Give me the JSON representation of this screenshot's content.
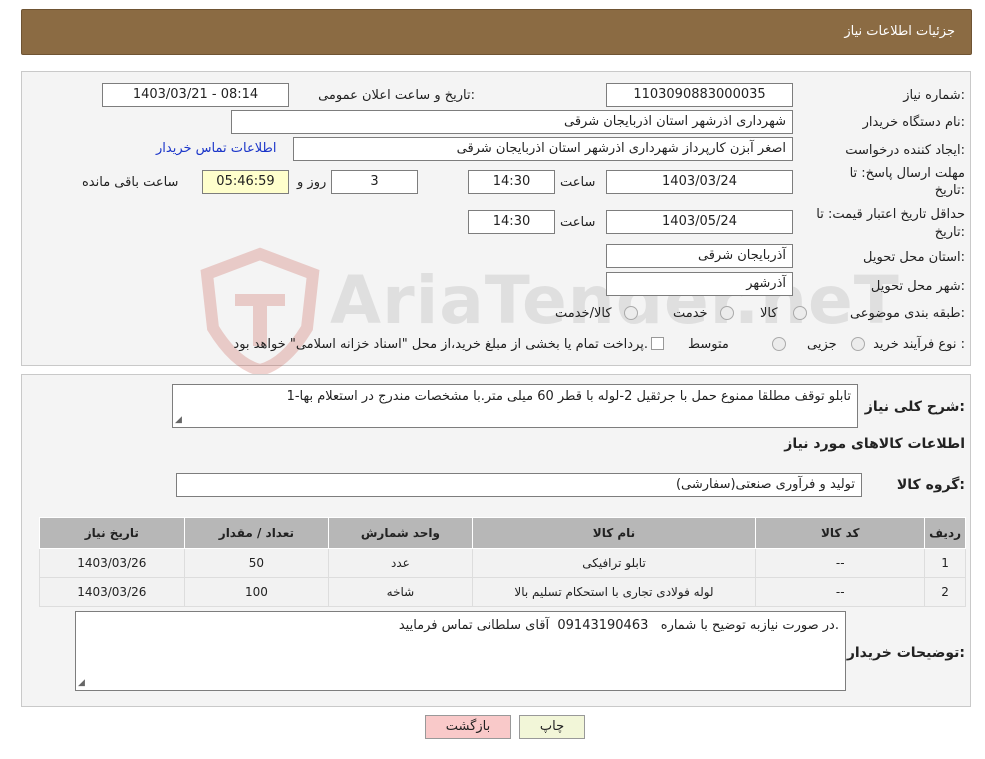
{
  "header": {
    "title": "جزئیات اطلاعات نیاز"
  },
  "form": {
    "need_number_label": "شماره نیاز:",
    "need_number": "1103090883000035",
    "announce_label": "تاریخ و ساعت اعلان عمومی:",
    "announce_value": "1403/03/21 - 08:14",
    "buyer_label": "نام دستگاه خریدار:",
    "buyer_value": "شهرداری اذرشهر استان اذربایجان شرقی",
    "creator_label": "ایجاد کننده درخواست:",
    "creator_value": "اصغر آبزن کارپرداز شهرداری اذرشهر استان اذربایجان شرقی",
    "contact_link": "اطلاعات تماس خریدار",
    "deadline_label_1": "مهلت ارسال پاسخ: تا",
    "deadline_label_2": "تاریخ:",
    "deadline_date": "1403/03/24",
    "time_label": "ساعت",
    "deadline_time": "14:30",
    "days_value": "3",
    "days_label": "روز و",
    "remaining_time": "05:46:59",
    "remaining_label": "ساعت باقی مانده",
    "validity_label_1": "حداقل تاریخ اعتبار قیمت: تا",
    "validity_label_2": "تاریخ:",
    "validity_date": "1403/05/24",
    "validity_time": "14:30",
    "province_label": "استان محل تحویل:",
    "province_value": "آذربایجان شرقی",
    "city_label": "شهر محل تحویل:",
    "city_value": "آذرشهر",
    "category_label": "طبقه بندی موضوعی:",
    "category_options": [
      "کالا",
      "خدمت",
      "کالا/خدمت"
    ],
    "process_label": "نوع فرآیند خرید :",
    "process_options": [
      "جزیی",
      "متوسط"
    ],
    "process_note": "پرداخت تمام یا بخشی از مبلغ خرید،از محل \"اسناد خزانه اسلامی\" خواهد بود."
  },
  "description": {
    "label": "شرح کلی نیاز:",
    "text": "1-تابلو توقف مطلقا ممنوع حمل با جرثقیل 2-لوله با قطر 60 میلی متر.با مشخصات مندرج در استعلام بها"
  },
  "goods": {
    "section_title": "اطلاعات کالاهای مورد نیاز",
    "group_label": "گروه کالا:",
    "group_value": "تولید و فرآوری صنعتی(سفارشی)",
    "columns": [
      "ردیف",
      "کد کالا",
      "نام کالا",
      "واحد شمارش",
      "تعداد / مقدار",
      "تاریخ نیاز"
    ],
    "rows": [
      [
        "1",
        "--",
        "تابلو ترافیکی",
        "عدد",
        "50",
        "1403/03/26"
      ],
      [
        "2",
        "--",
        "لوله فولادی تجاری با استحکام تسلیم بالا",
        "شاخه",
        "100",
        "1403/03/26"
      ]
    ]
  },
  "buyer_notes": {
    "label": "توضیحات خریدار:",
    "text": "در صورت نیازبه توضیح با شماره   09143190463  آقای سلطانی تماس فرمایید."
  },
  "buttons": {
    "print": "چاپ",
    "back": "بازگشت"
  },
  "watermark": {
    "text": "AriaTender.neT"
  },
  "colors": {
    "header": "#8b6b43",
    "table_header": "#b7b7b7",
    "back_button": "#f9c9c9",
    "print_button": "#f2f6d8",
    "link": "#1a35c9"
  }
}
